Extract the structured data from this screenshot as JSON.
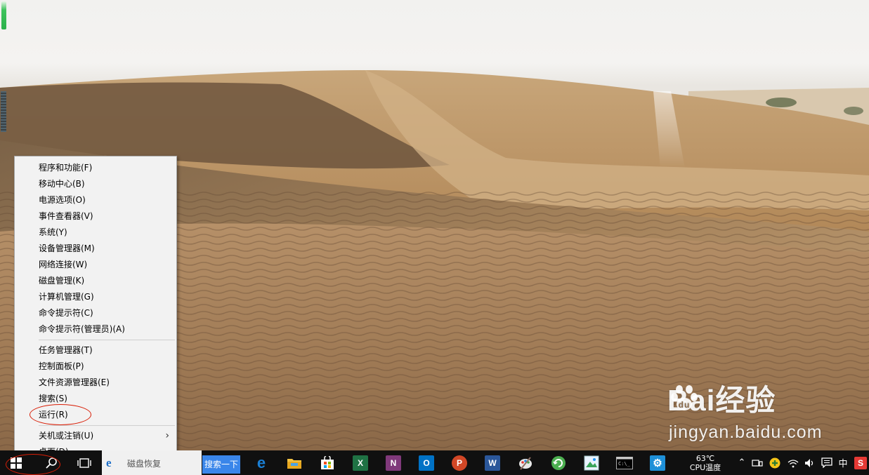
{
  "context_menu": {
    "group1": [
      "程序和功能(F)",
      "移动中心(B)",
      "电源选项(O)",
      "事件查看器(V)",
      "系统(Y)",
      "设备管理器(M)",
      "网络连接(W)",
      "磁盘管理(K)",
      "计算机管理(G)",
      "命令提示符(C)",
      "命令提示符(管理员)(A)"
    ],
    "group2": [
      "任务管理器(T)",
      "控制面板(P)",
      "文件资源管理器(E)",
      "搜索(S)",
      "运行(R)"
    ],
    "group3": [
      "关机或注销(U)",
      "桌面(D)"
    ],
    "submenu_arrow": "›"
  },
  "taskbar": {
    "ie_tab_label": "磁盘恢复",
    "search_button": "搜索一下",
    "apps": [
      {
        "icon": "edge-icon",
        "glyph": "e",
        "color": "#1a7fd4"
      },
      {
        "icon": "file-explorer-icon",
        "glyph": "",
        "color": "#f5c342"
      },
      {
        "icon": "store-icon",
        "glyph": "⊞",
        "color": "#ffffff"
      },
      {
        "icon": "excel-icon",
        "glyph": "X",
        "color": "#1f7244"
      },
      {
        "icon": "onenote-icon",
        "glyph": "N",
        "color": "#80397b"
      },
      {
        "icon": "outlook-icon",
        "glyph": "O",
        "color": "#0072c6"
      },
      {
        "icon": "powerpoint-icon",
        "glyph": "P",
        "color": "#d24726"
      },
      {
        "icon": "word-icon",
        "glyph": "W",
        "color": "#2b579a"
      },
      {
        "icon": "paint-icon",
        "glyph": "✎",
        "color": "#6fa8dc"
      },
      {
        "icon": "green-app-icon",
        "glyph": "↻",
        "color": "#4caf50"
      },
      {
        "icon": "photos-app-icon",
        "glyph": "◆",
        "color": "#3aa55a"
      },
      {
        "icon": "cmd-icon",
        "glyph": ">_",
        "color": "#000000"
      },
      {
        "icon": "settings-icon",
        "glyph": "⚙",
        "color": "#1e90d8"
      }
    ],
    "cpu_temp_value": "63℃",
    "cpu_temp_label": "CPU温度",
    "ime_label": "中"
  },
  "watermark": {
    "brand_left": "Bai",
    "brand_right": "经验",
    "url": "jingyan.baidu.com"
  }
}
